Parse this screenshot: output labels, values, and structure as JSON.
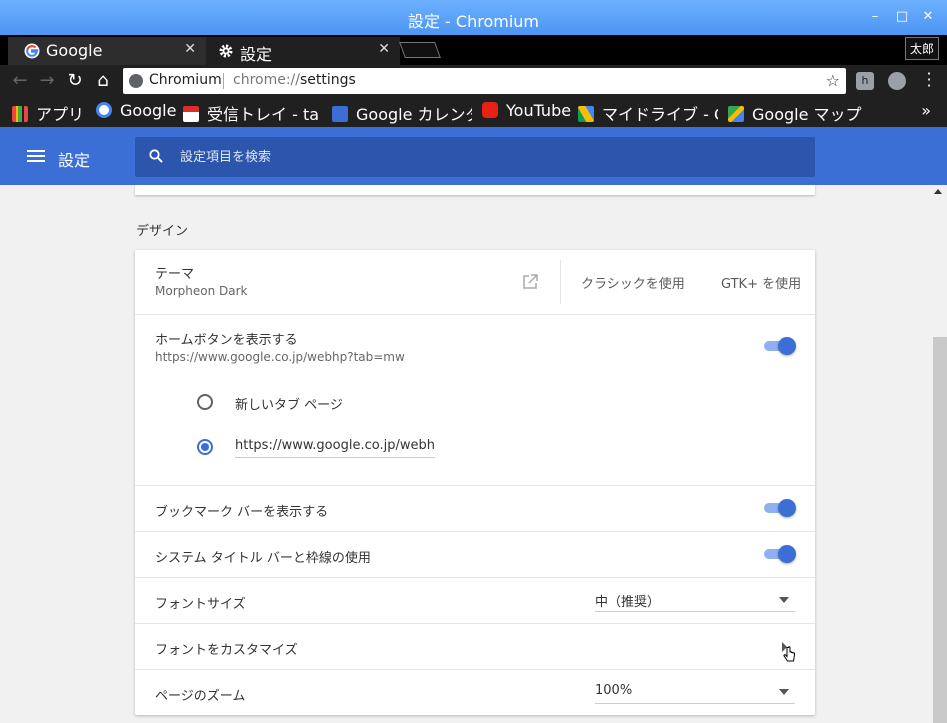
{
  "window": {
    "title": "設定 - Chromium",
    "controls": {
      "minimize": "–",
      "maximize": "□",
      "close": "✕"
    }
  },
  "tabs": [
    {
      "label": "Google",
      "close": "✕",
      "icon": "google-g-icon"
    },
    {
      "label": "設定",
      "close": "✕",
      "icon": "gear-icon"
    }
  ],
  "profile": {
    "name": "太郎"
  },
  "toolbar": {
    "back": "←",
    "forward": "→",
    "reload": "↻",
    "home": "⌂",
    "omnibox": {
      "site_name": "Chromium",
      "url_scheme": "chrome://",
      "url_path": "settings"
    },
    "star": "☆"
  },
  "bookmarks": {
    "items": [
      {
        "label": "アプリ",
        "icon": "apps-grid-icon"
      },
      {
        "label": "Google",
        "icon": "google-g-icon"
      },
      {
        "label": "受信トレイ - tar",
        "icon": "gmail-icon"
      },
      {
        "label": "Google カレンダ",
        "icon": "calendar-icon"
      },
      {
        "label": "YouTube",
        "icon": "youtube-icon"
      },
      {
        "label": "マイドライブ - G",
        "icon": "drive-icon"
      },
      {
        "label": "Google マップ",
        "icon": "maps-icon"
      }
    ],
    "more": "»"
  },
  "settings": {
    "title": "設定",
    "search_placeholder": "設定項目を検索",
    "section_title": "デザイン",
    "theme": {
      "label": "テーマ",
      "value": "Morpheon Dark",
      "classic_button": "クラシックを使用",
      "gtk_button": "GTK+ を使用"
    },
    "home_button": {
      "label": "ホームボタンを表示する",
      "url": "https://www.google.co.jp/webhp?tab=mw",
      "enabled": true,
      "option_new_tab": "新しいタブ ページ",
      "option_custom_value": "https://www.google.co.jp/webhp?ta",
      "selected": "custom"
    },
    "bookmarks_bar": {
      "label": "ブックマーク バーを表示する",
      "enabled": true
    },
    "system_title_bar": {
      "label": "システム タイトル バーと枠線の使用",
      "enabled": true
    },
    "font_size": {
      "label": "フォントサイズ",
      "value": "中（推奨）"
    },
    "customize_fonts": {
      "label": "フォントをカスタマイズ"
    },
    "page_zoom": {
      "label": "ページのズーム",
      "value": "100%"
    }
  },
  "colors": {
    "accent": "#3b6fd6",
    "titlebar": "#5aa2f8",
    "chrome_dark": "#202020"
  }
}
